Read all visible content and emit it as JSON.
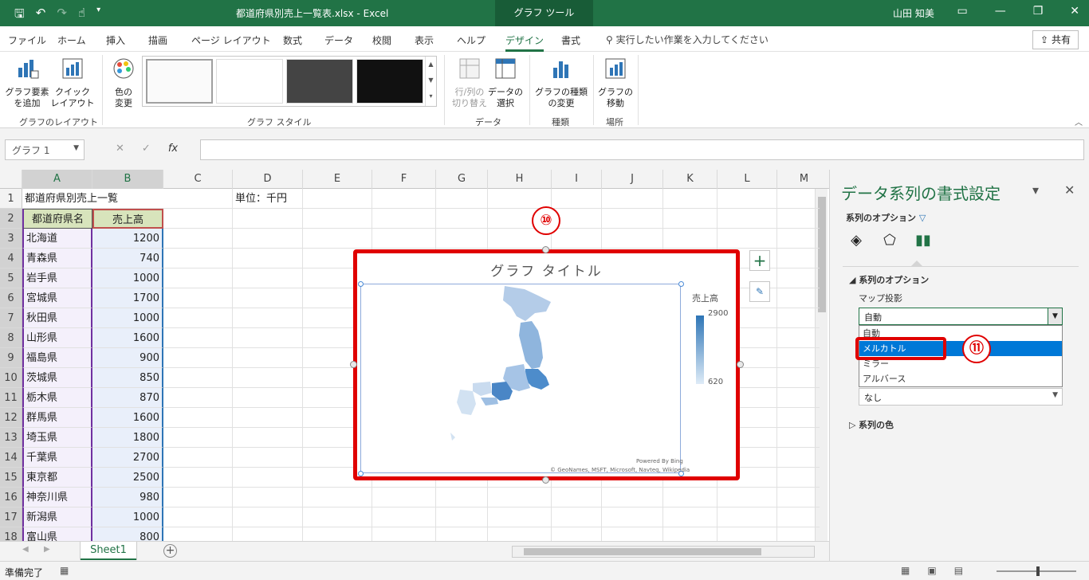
{
  "window": {
    "title": "都道府県別売上一覧表.xlsx  -  Excel",
    "tool_tab": "グラフ ツール",
    "user": "山田 知美"
  },
  "menu": {
    "tabs": [
      "ファイル",
      "ホーム",
      "挿入",
      "描画",
      "ページ レイアウト",
      "数式",
      "データ",
      "校閲",
      "表示",
      "ヘルプ",
      "デザイン",
      "書式"
    ],
    "active_tab": "デザイン",
    "search_placeholder": "実行したい作業を入力してください",
    "share": "共有"
  },
  "ribbon": {
    "add_element": "グラフ要素\nを追加",
    "quick_layout": "クイック\nレイアウト",
    "change_colors": "色の\n変更",
    "switch_row_col": "行/列の\n切り替え",
    "select_data": "データの\n選択",
    "change_type": "グラフの種類\nの変更",
    "move_chart": "グラフの\n移動",
    "group_layout": "グラフのレイアウト",
    "group_style": "グラフ スタイル",
    "group_data": "データ",
    "group_type": "種類",
    "group_location": "場所"
  },
  "formula_bar": {
    "name_box": "グラフ 1",
    "fx": "fx",
    "cancel": "✕",
    "confirm": "✓"
  },
  "grid": {
    "columns": [
      "A",
      "B",
      "C",
      "D",
      "E",
      "F",
      "G",
      "H",
      "I",
      "J",
      "K",
      "L",
      "M"
    ],
    "rows": [
      "1",
      "2",
      "3",
      "4",
      "5",
      "6",
      "7",
      "8",
      "9",
      "10",
      "11",
      "12",
      "13",
      "14",
      "15",
      "16",
      "17",
      "18"
    ],
    "a1": "都道府県別売上一覧",
    "d1": "単位：千円",
    "header_a": "都道府県名",
    "header_b": "売上高",
    "data_rows": [
      {
        "pref": "北海道",
        "sales": "1200"
      },
      {
        "pref": "青森県",
        "sales": "740"
      },
      {
        "pref": "岩手県",
        "sales": "1000"
      },
      {
        "pref": "宮城県",
        "sales": "1700"
      },
      {
        "pref": "秋田県",
        "sales": "1000"
      },
      {
        "pref": "山形県",
        "sales": "1600"
      },
      {
        "pref": "福島県",
        "sales": "900"
      },
      {
        "pref": "茨城県",
        "sales": "850"
      },
      {
        "pref": "栃木県",
        "sales": "870"
      },
      {
        "pref": "群馬県",
        "sales": "1600"
      },
      {
        "pref": "埼玉県",
        "sales": "1800"
      },
      {
        "pref": "千葉県",
        "sales": "2700"
      },
      {
        "pref": "東京都",
        "sales": "2500"
      },
      {
        "pref": "神奈川県",
        "sales": "980"
      },
      {
        "pref": "新潟県",
        "sales": "1000"
      },
      {
        "pref": "富山県",
        "sales": "800"
      }
    ]
  },
  "chart": {
    "title": "グラフ タイトル",
    "legend_title": "売上高",
    "legend_max": "2900",
    "legend_min": "620",
    "powered_by": "Powered By Bing",
    "copyright": "© GeoNames, MSFT, Microsoft, Navteq, Wikipedia",
    "color_dark": "#2e75b6",
    "color_light": "#deebf7"
  },
  "annotations": {
    "step10": "⑩",
    "step11": "⑪"
  },
  "pane": {
    "title": "データ系列の書式設定",
    "series_options": "系列のオプション",
    "section_series_options": "系列のオプション",
    "projection_label": "マップ投影",
    "projection_value": "自動",
    "projection_options": [
      "自動",
      "メルカトル",
      "ミラー",
      "アルバース"
    ],
    "highlighted_option": "メルカトル",
    "label_value": "なし",
    "series_color": "系列の色"
  },
  "sheet": {
    "tab": "Sheet1"
  },
  "status": {
    "ready": "準備完了"
  }
}
